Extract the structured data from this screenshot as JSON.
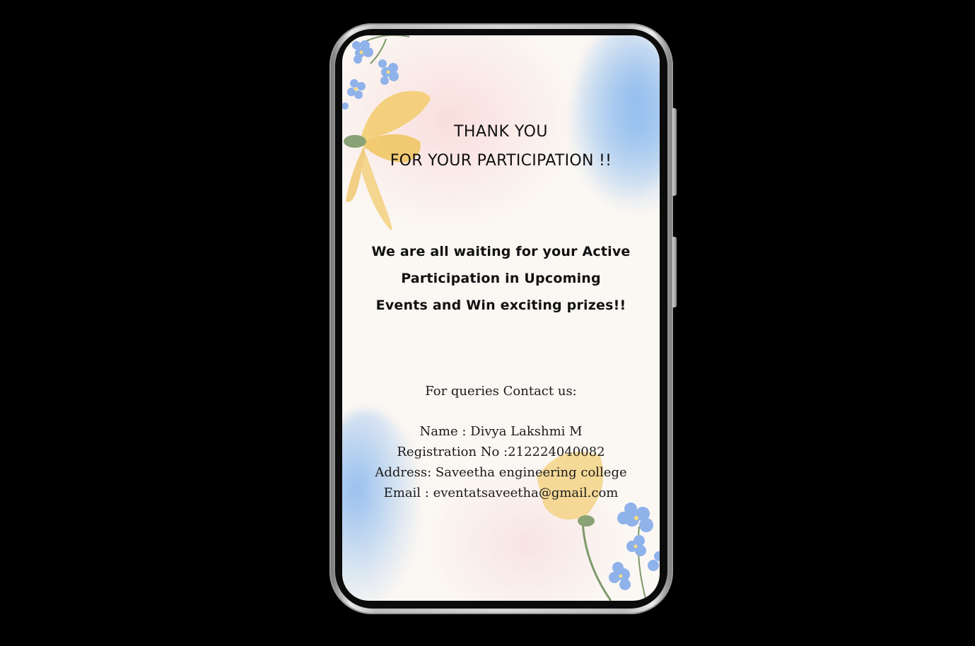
{
  "card": {
    "title_line_1": "THANK YOU",
    "title_line_2": "FOR YOUR PARTICIPATION !!",
    "message_lines": [
      "We are all waiting for your Active",
      "Participation in Upcoming",
      "Events and Win exciting prizes!!"
    ],
    "contact_heading": "For queries Contact us:",
    "contact": {
      "name": "Name :  Divya Lakshmi M",
      "registration": "Registration No :212224040082",
      "address": "Address:  Saveetha engineering college",
      "email": "Email : eventatsaveetha@gmail.com"
    }
  },
  "colors": {
    "background": "#000000",
    "screen": "#fbf7f3",
    "text": "#111111",
    "flower_yellow": "#f3cf78",
    "flower_blue": "#8fb2ea",
    "wash_blue": "#a8c9f0"
  },
  "icons": [
    "phone-frame",
    "yellow-flower-icon",
    "blue-forget-me-not-icon"
  ]
}
